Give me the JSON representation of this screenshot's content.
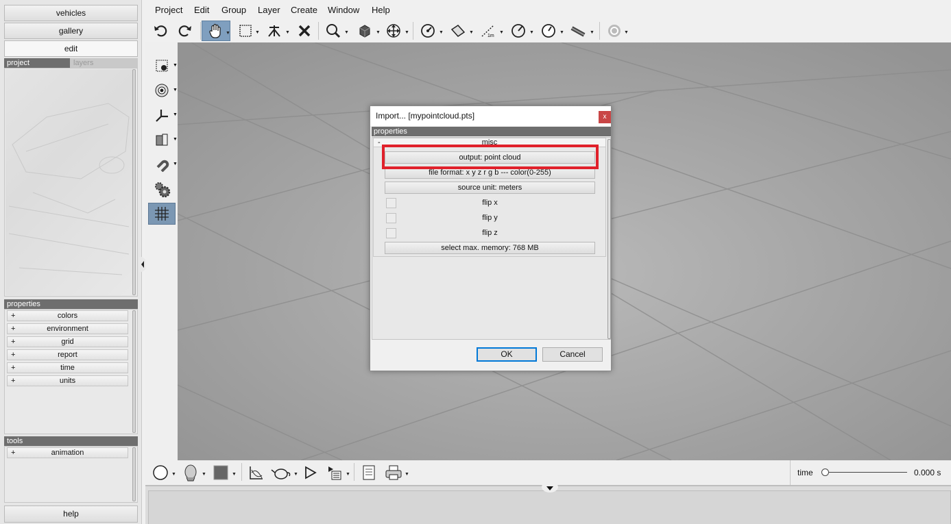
{
  "left_panel": {
    "nav": {
      "vehicles": "vehicles",
      "gallery": "gallery",
      "edit": "edit",
      "help": "help"
    },
    "tabs": {
      "project": "project",
      "layers": "layers"
    },
    "properties_header": "properties",
    "properties_items": [
      "colors",
      "environment",
      "grid",
      "report",
      "time",
      "units"
    ],
    "tools_header": "tools",
    "tools_items": [
      "animation"
    ],
    "expand_symbol": "+"
  },
  "menubar": [
    "Project",
    "Edit",
    "Group",
    "Layer",
    "Create",
    "Window",
    "Help"
  ],
  "toolbar": {
    "icons": [
      "undo-icon",
      "redo-icon",
      "pan-hand-icon",
      "select-rectangle-icon",
      "tripod-icon",
      "delete-x-icon",
      "zoom-icon",
      "view-cube-icon",
      "move-icon",
      "measure-angle-icon",
      "measure-area-icon",
      "measure-distance-icon",
      "measure-radius-icon",
      "measure-gauge-icon",
      "tape-measure-icon",
      "help-icon"
    ],
    "selected": "pan-hand-icon"
  },
  "side_tools": {
    "icons": [
      "add-point-icon",
      "target-icon",
      "axis-icon",
      "cross-section-icon",
      "magnet-icon",
      "settings-gears-icon",
      "grid-icon"
    ],
    "selected": "grid-icon"
  },
  "bottom_toolbar": {
    "icons": [
      "sphere-icon",
      "head-icon",
      "color-swatch-icon",
      "chart-icon",
      "teapot-icon",
      "play-icon",
      "playlist-icon",
      "document-icon",
      "print-icon"
    ]
  },
  "timeline": {
    "label": "time",
    "value": "0.000 s",
    "slider_fraction": 0.0
  },
  "dialog": {
    "title": "Import... [mypointcloud.pts]",
    "close": "x",
    "properties_header": "properties",
    "group_label": "misc",
    "group_toggle": "-",
    "rows": {
      "output": "output: point cloud",
      "file_format": "file format: x y z r g b --- color(0-255)",
      "source_unit": "source unit: meters",
      "flip_x": "flip x",
      "flip_y": "flip y",
      "flip_z": "flip z",
      "memory": "select max. memory: 768 MB"
    },
    "ok": "OK",
    "cancel": "Cancel"
  },
  "colors": {
    "highlight": "#e0212b",
    "selected_tool": "#7f9fbf",
    "viewport": "#a3a3a3"
  }
}
